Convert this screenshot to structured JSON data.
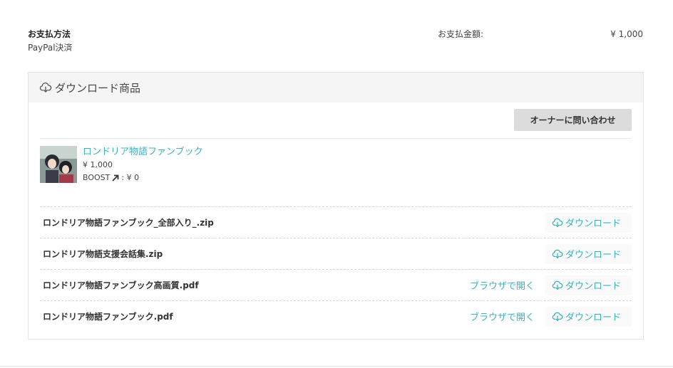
{
  "payment": {
    "method_label": "お支払方法",
    "method_value": "PayPal決済",
    "amount_label": "お支払金額:",
    "amount_value": "¥ 1,000"
  },
  "panel": {
    "title": "ダウンロード商品",
    "title_icon": "cloud-download-icon",
    "contact_label": "オーナーに問い合わせ"
  },
  "product": {
    "name": "ロンドリア物語ファンブック",
    "price": "¥ 1,000",
    "boost_label": "BOOST",
    "boost_value": ": ¥ 0",
    "boost_icon": "arrow-up-right-icon"
  },
  "files": [
    {
      "name": "ロンドリア物語ファンブック_全部入り_.zip",
      "open_label": "",
      "download_label": "ダウンロード"
    },
    {
      "name": "ロンドリア物語支援会話集.zip",
      "open_label": "",
      "download_label": "ダウンロード"
    },
    {
      "name": "ロンドリア物語ファンブック高画質.pdf",
      "open_label": "ブラウザで開く",
      "download_label": "ダウンロード"
    },
    {
      "name": "ロンドリア物語ファンブック.pdf",
      "open_label": "ブラウザで開く",
      "download_label": "ダウンロード"
    }
  ],
  "colors": {
    "accent": "#3bb3bd",
    "header_bg": "#f5f5f5",
    "button_bg": "#dcdcdc"
  }
}
